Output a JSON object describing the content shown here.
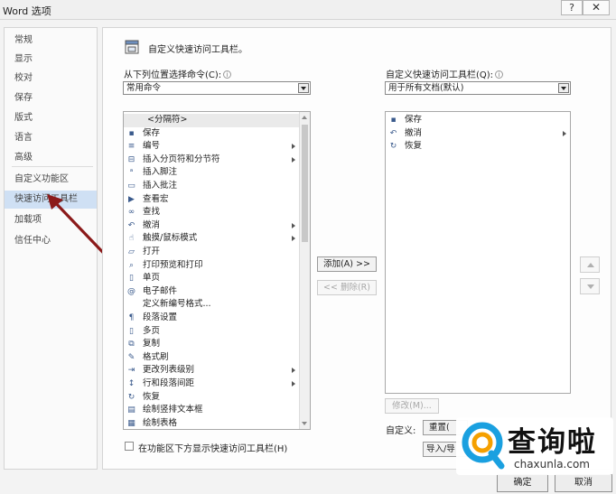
{
  "window": {
    "title": "Word 选项",
    "help": "?",
    "close": "✕"
  },
  "nav": {
    "items": [
      {
        "label": "常规"
      },
      {
        "label": "显示"
      },
      {
        "label": "校对"
      },
      {
        "label": "保存"
      },
      {
        "label": "版式"
      },
      {
        "label": "语言"
      },
      {
        "label": "高级"
      },
      {
        "label": "自定义功能区"
      },
      {
        "label": "快速访问工具栏",
        "active": true
      },
      {
        "label": "加载项"
      },
      {
        "label": "信任中心"
      }
    ]
  },
  "header": {
    "title": "自定义快速访问工具栏。"
  },
  "left": {
    "choose_label": "从下列位置选择命令(C):",
    "choose_value": "常用命令",
    "commands": [
      {
        "icon": "",
        "label": "<分隔符>",
        "submenu": false,
        "selected": true
      },
      {
        "icon": "save-icon",
        "label": "保存",
        "submenu": false
      },
      {
        "icon": "numbering-icon",
        "label": "编号",
        "submenu": true
      },
      {
        "icon": "section-break-icon",
        "label": "插入分页符和分节符",
        "submenu": true
      },
      {
        "icon": "footnote-icon",
        "label": "插入脚注",
        "submenu": false
      },
      {
        "icon": "comment-icon",
        "label": "插入批注",
        "submenu": false
      },
      {
        "icon": "play-icon",
        "label": "查看宏",
        "submenu": false
      },
      {
        "icon": "binoculars-icon",
        "label": "查找",
        "submenu": false
      },
      {
        "icon": "undo-icon",
        "label": "撤消",
        "submenu": true
      },
      {
        "icon": "touch-icon",
        "label": "触摸/鼠标模式",
        "submenu": true
      },
      {
        "icon": "open-folder-icon",
        "label": "打开",
        "submenu": false
      },
      {
        "icon": "print-preview-icon",
        "label": "打印预览和打印",
        "submenu": false
      },
      {
        "icon": "page-icon",
        "label": "单页",
        "submenu": false
      },
      {
        "icon": "email-icon",
        "label": "电子邮件",
        "submenu": false
      },
      {
        "icon": "",
        "label": "定义新编号格式...",
        "submenu": false
      },
      {
        "icon": "paragraph-icon",
        "label": "段落设置",
        "submenu": false
      },
      {
        "icon": "multi-page-icon",
        "label": "多页",
        "submenu": false
      },
      {
        "icon": "copy-icon",
        "label": "复制",
        "submenu": false
      },
      {
        "icon": "format-painter-icon",
        "label": "格式刷",
        "submenu": false
      },
      {
        "icon": "indent-icon",
        "label": "更改列表级别",
        "submenu": true
      },
      {
        "icon": "line-spacing-icon",
        "label": "行和段落间距",
        "submenu": true
      },
      {
        "icon": "redo-icon",
        "label": "恢复",
        "submenu": false
      },
      {
        "icon": "textbox-icon",
        "label": "绘制竖排文本框",
        "submenu": false
      },
      {
        "icon": "table-icon",
        "label": "绘制表格",
        "submenu": false
      }
    ],
    "show_below_label": "在功能区下方显示快速访问工具栏(H)",
    "show_below_checked": false
  },
  "middle": {
    "add_label": "添加(A) >>",
    "remove_label": "<< 删除(R)"
  },
  "right": {
    "customize_label": "自定义快速访问工具栏(Q):",
    "customize_value": "用于所有文档(默认)",
    "items": [
      {
        "icon": "save-icon",
        "label": "保存",
        "submenu": false
      },
      {
        "icon": "undo-icon",
        "label": "撤消",
        "submenu": true
      },
      {
        "icon": "redo-icon",
        "label": "恢复",
        "submenu": false
      }
    ],
    "modify_label": "修改(M)...",
    "custom_label": "自定义:",
    "reset_label": "重置(",
    "import_label": "导入/导"
  },
  "footer": {
    "ok_label": "确定",
    "cancel_label": "取消"
  },
  "watermark": {
    "big": "查询啦",
    "small": "chaxunla.com"
  },
  "colors": {
    "accent": "#2b579a",
    "nav_active": "#cfe0f4",
    "arrow": "#8b1a1a",
    "watermark_blue": "#1aa0e0",
    "watermark_orange": "#f5a000"
  }
}
